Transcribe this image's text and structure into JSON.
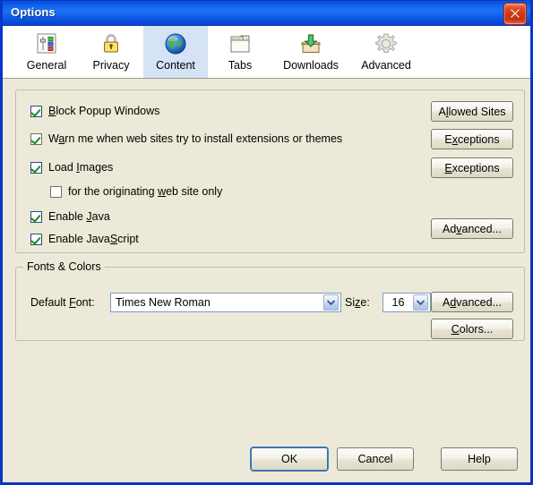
{
  "window": {
    "title": "Options",
    "close_icon": "close-icon",
    "accent_titlebar": "#1260EE",
    "dialog_background": "#ECE9D8",
    "border_color": "#0A36C8"
  },
  "tabs": [
    {
      "id": "general",
      "label": "General",
      "icon": "sliders-icon",
      "selected": false
    },
    {
      "id": "privacy",
      "label": "Privacy",
      "icon": "padlock-icon",
      "selected": false
    },
    {
      "id": "content",
      "label": "Content",
      "icon": "globe-icon",
      "selected": true
    },
    {
      "id": "tabs",
      "label": "Tabs",
      "icon": "tabs-icon",
      "selected": false
    },
    {
      "id": "downloads",
      "label": "Downloads",
      "icon": "download-box-icon",
      "selected": false
    },
    {
      "id": "advanced",
      "label": "Advanced",
      "icon": "gear-icon",
      "selected": false
    }
  ],
  "content_group": {
    "checkboxes": [
      {
        "id": "block-popup-windows",
        "label": "Block Popup Windows",
        "accesskey": "B",
        "checked": true
      },
      {
        "id": "warn-install-extensions",
        "label": "Warn me when web sites try to install extensions or themes",
        "accesskey": "a",
        "checked": true
      },
      {
        "id": "load-images",
        "label": "Load Images",
        "accesskey": "I",
        "checked": true
      },
      {
        "id": "originating-site-only",
        "label": "for the originating web site only",
        "accesskey": "w",
        "checked": false
      },
      {
        "id": "enable-java",
        "label": "Enable Java",
        "accesskey": "J",
        "checked": true
      },
      {
        "id": "enable-javascript",
        "label": "Enable JavaScript",
        "accesskey": "S",
        "checked": true
      }
    ],
    "buttons": {
      "allowed_sites": "Allowed Sites",
      "exceptions_1": "Exceptions",
      "exceptions_2": "Exceptions",
      "advanced": "Advanced..."
    }
  },
  "fonts_group": {
    "legend": "Fonts & Colors",
    "default_font_label": "Default Font:",
    "default_font_value": "Times New Roman",
    "size_label": "Size:",
    "size_value": "16",
    "buttons": {
      "advanced": "Advanced...",
      "colors": "Colors..."
    }
  },
  "footer": {
    "ok": "OK",
    "cancel": "Cancel",
    "help": "Help"
  }
}
